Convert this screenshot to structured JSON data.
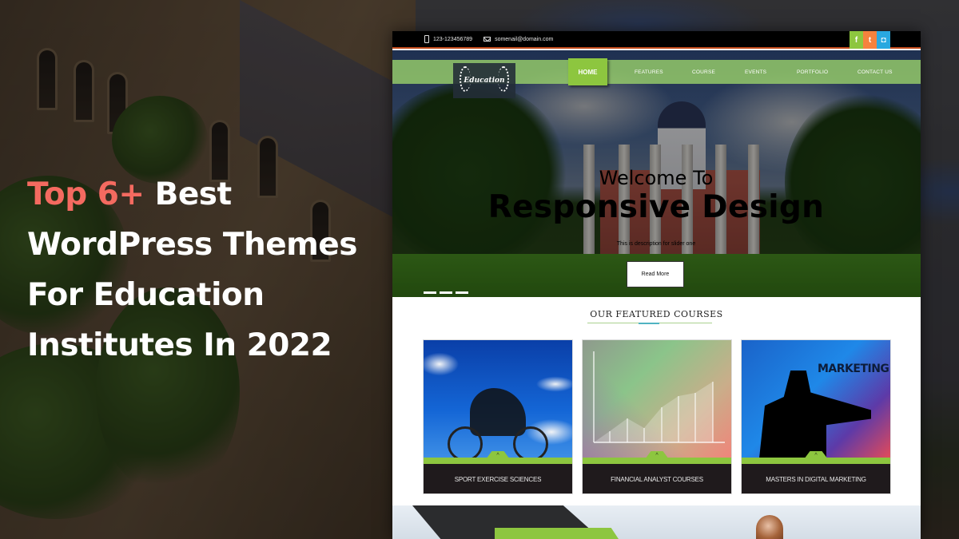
{
  "headline": {
    "accent": "Top 6+",
    "line1_rest": " Best",
    "line2": "WordPress Themes",
    "line3": "For Education",
    "line4": "Institutes In 2022"
  },
  "colors": {
    "accent_red": "#f46a60",
    "brand_green": "#8dc63f",
    "facebook": "#8dc63f",
    "twitter": "#f5823e",
    "instagram": "#29a8e0"
  },
  "mockup": {
    "topbar": {
      "phone_icon": "phone-icon",
      "phone": "123-123456789",
      "email_icon": "mail-icon",
      "email": "somenail@domain.com",
      "social": [
        {
          "name": "facebook-icon",
          "glyph": "f"
        },
        {
          "name": "twitter-icon",
          "glyph": "t"
        },
        {
          "name": "instagram-icon",
          "glyph": "◘"
        }
      ]
    },
    "logo": "Education",
    "nav": [
      "HOME",
      "FEATURES",
      "COURSE",
      "EVENTS",
      "PORTFOLIO",
      "CONTACT US"
    ],
    "nav_active": "HOME",
    "hero": {
      "welcome": "Welcome To",
      "title": "Responsive Design",
      "description": "This is description for slider one",
      "button": "Read More",
      "slide_count": 3
    },
    "featured": {
      "title": "OUR FEATURED COURSES",
      "cards": [
        {
          "caption": "SPORT EXERCISE SCIENCES",
          "image": "cyclist"
        },
        {
          "caption": "FINANCIAL ANALYST COURSES",
          "image": "growth-chart"
        },
        {
          "caption": "MASTERS IN DIGITAL MARKETING",
          "image": "internet-marketing",
          "image_text": "MARKETING"
        }
      ],
      "card_toggle_glyph": "^"
    }
  }
}
